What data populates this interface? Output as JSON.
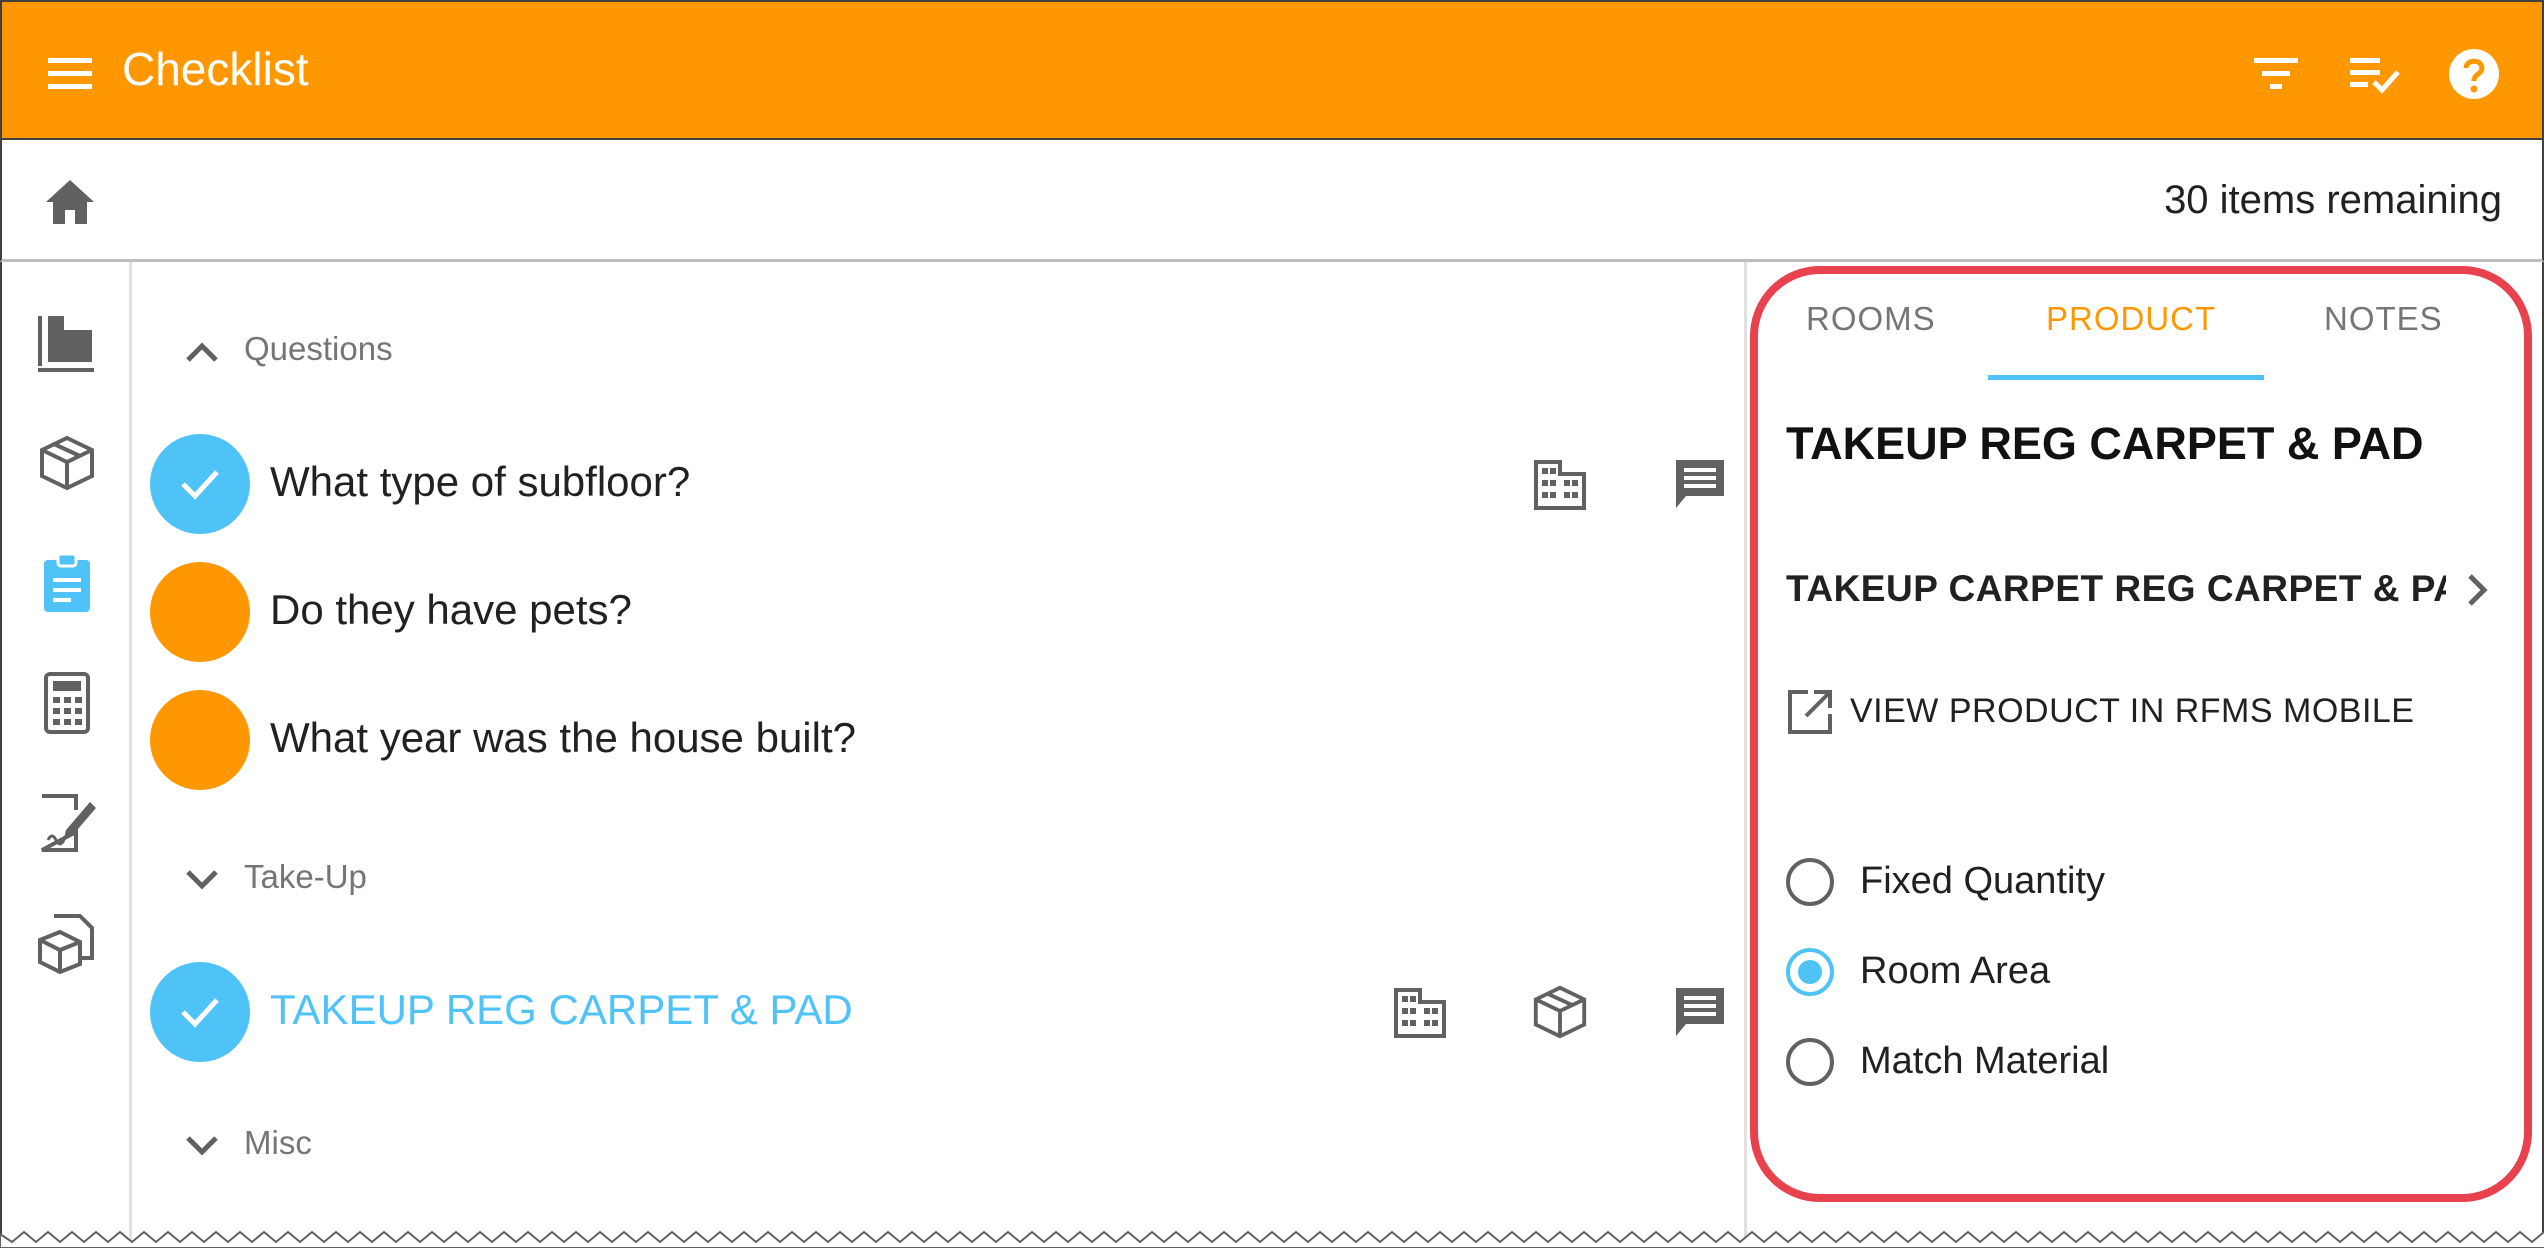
{
  "app": {
    "title": "Checklist"
  },
  "toolbar": {
    "menu_icon": "menu-icon",
    "actions": [
      "filter-icon",
      "checklist-icon",
      "help-icon"
    ]
  },
  "breadcrumb": {
    "home_icon": "home-icon",
    "remaining": "30 items remaining"
  },
  "rail": {
    "items": [
      "floorplan-icon",
      "product-box-icon",
      "clipboard-icon",
      "calculator-icon",
      "signature-icon",
      "documents-icon"
    ],
    "active": "clipboard-icon"
  },
  "sections": {
    "questions": {
      "label": "Questions",
      "expanded": true
    },
    "takeup": {
      "label": "Take-Up",
      "expanded": false
    },
    "misc": {
      "label": "Misc",
      "expanded": false
    }
  },
  "questions": [
    {
      "label": "What type of subfloor?",
      "status": "done"
    },
    {
      "label": "Do they have pets?",
      "status": "todo"
    },
    {
      "label": "What year was the house built?",
      "status": "todo"
    }
  ],
  "takeup_items": [
    {
      "label": "TAKEUP REG CARPET & PAD",
      "status": "done"
    }
  ],
  "panel": {
    "tabs": [
      "ROOMS",
      "PRODUCT",
      "NOTES"
    ],
    "active_tab": "PRODUCT",
    "product_title": "TAKEUP REG CARPET & PAD",
    "product_subtitle": "TAKEUP CARPET REG CARPET & PAD",
    "view_link": "VIEW PRODUCT IN RFMS MOBILE",
    "options": [
      "Fixed Quantity",
      "Room Area",
      "Match Material"
    ],
    "selected_option": "Room Area"
  },
  "colors": {
    "accent": "#ff9800",
    "primary": "#4fc3f7",
    "highlight": "#e8424f"
  }
}
